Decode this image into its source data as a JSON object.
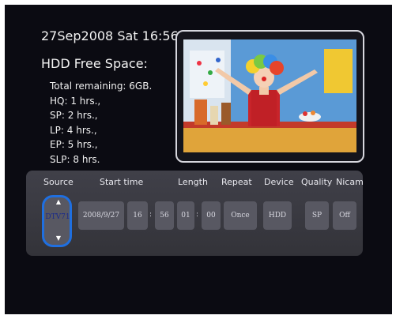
{
  "status": {
    "datetime": "27Sep2008 Sat 16:56",
    "hdd_title": "HDD Free Space:",
    "lines": [
      "Total remaining: 6GB.",
      "HQ: 1 hrs.,",
      "SP: 2 hrs.,",
      "LP: 4 hrs.,",
      "EP: 5 hrs.,",
      "SLP: 8 hrs."
    ]
  },
  "schedule": {
    "headers": {
      "source": "Source",
      "start_time": "Start time",
      "length": "Length",
      "repeat": "Repeat",
      "device": "Device",
      "quality": "Quality",
      "nicam": "Nicam"
    },
    "values": {
      "source": "DTV71",
      "date": "2008/9/27",
      "start_hour": "16",
      "start_min": "56",
      "length_hour": "01",
      "length_min": "00",
      "repeat": "Once",
      "device": "HDD",
      "quality": "SP",
      "nicam": "Off"
    },
    "separator": ":"
  },
  "colors": {
    "selection": "#1f6fe0",
    "panel": "#3a3a42",
    "cell": "#585862"
  },
  "icons": {
    "source_up": "up-arrow-icon",
    "source_down": "down-arrow-icon"
  }
}
